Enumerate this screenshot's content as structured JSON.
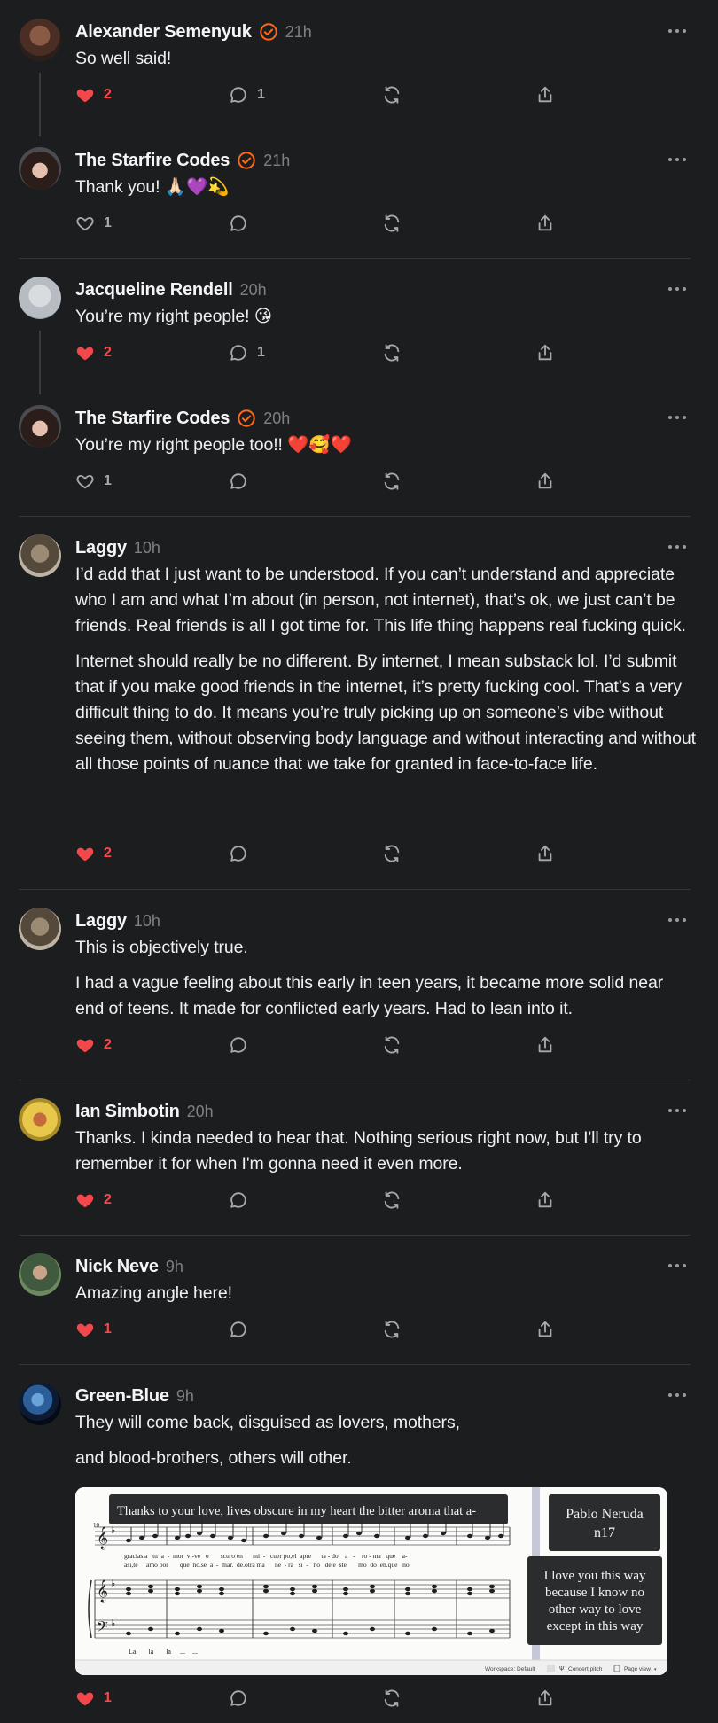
{
  "comments": [
    {
      "author": "Alexander Semenyuk",
      "time": "21h",
      "verified": true,
      "text": [
        "So well said!"
      ],
      "likes": "2",
      "liked": true,
      "replies": "1"
    },
    {
      "author": "The Starfire Codes",
      "time": "21h",
      "verified": true,
      "text": [
        "Thank you! 🙏🏻💜💫"
      ],
      "likes": "1",
      "liked": false,
      "replies": ""
    },
    {
      "author": "Jacqueline Rendell",
      "time": "20h",
      "verified": false,
      "text": [
        "You’re my right people! 😘"
      ],
      "likes": "2",
      "liked": true,
      "replies": "1"
    },
    {
      "author": "The Starfire Codes",
      "time": "20h",
      "verified": true,
      "text": [
        "You’re my right people too!! ❤️🥰❤️"
      ],
      "likes": "1",
      "liked": false,
      "replies": ""
    },
    {
      "author": "Laggy",
      "time": "10h",
      "verified": false,
      "text": [
        "I’d add that I just want to be understood. If you can’t understand and appreciate who I am and what I’m about (in person, not internet), that’s ok, we just can’t be friends. Real friends is all I got time for. This life thing happens real fucking quick.",
        "Internet should really be no different. By internet, I mean substack lol. I’d submit that if you make good friends in the internet, it’s pretty fucking cool. That’s a very difficult thing to do. It means you’re truly picking up on someone’s vibe without seeing them, without observing body language and without interacting and without all those points of nuance that we take for granted in face-to-face life."
      ],
      "likes": "2",
      "liked": true,
      "replies": ""
    },
    {
      "author": "Laggy",
      "time": "10h",
      "verified": false,
      "text": [
        "This is objectively true.",
        "I had a vague feeling about this early in teen years, it became more solid near end of teens. It made for conflicted early years. Had to lean into it."
      ],
      "likes": "2",
      "liked": true,
      "replies": ""
    },
    {
      "author": "Ian Simbotin",
      "time": "20h",
      "verified": false,
      "text": [
        "Thanks. I kinda needed to hear that. Nothing serious right now, but I'll try to remember it for when I'm gonna need it even more."
      ],
      "likes": "2",
      "liked": true,
      "replies": ""
    },
    {
      "author": "Nick Neve",
      "time": "9h",
      "verified": false,
      "text": [
        "Amazing angle here!"
      ],
      "likes": "1",
      "liked": true,
      "replies": ""
    },
    {
      "author": "Green-Blue",
      "time": "9h",
      "verified": false,
      "text": [
        "They will come back, disguised as lovers, mothers,",
        "and blood-brothers, others will other."
      ],
      "likes": "1",
      "liked": true,
      "replies": ""
    }
  ],
  "attachment": {
    "banner": "Thanks to your love, lives obscure in my heart the bitter aroma that a-",
    "title_line1": "Pablo Neruda",
    "title_line2": "n17",
    "quote": [
      "I love you this way",
      "because I know no",
      "other way to love",
      "except in this way"
    ],
    "measure_number": "10",
    "lyrics1": "gracias.a   tu  a  -  mor  vi-ve   o       scuro en      mi  -   cuer po,el  apre      ta - do    a   -    ro - ma   que    a-",
    "lyrics2": "asi,te     amo por       que  no.se  a  -  mar.  de.otra ma      ne  - ra   si  -   no   de.e  ste       mo  do  en.que   no",
    "lyrics3": "La       la       la     ...    ...",
    "status_workspace": "Workspace: Default",
    "status_concert": "Concert pitch",
    "status_view": "Page view"
  },
  "colors": {
    "like": "#f2484b",
    "verified": "#ff6719",
    "background": "#1c1d1f"
  }
}
